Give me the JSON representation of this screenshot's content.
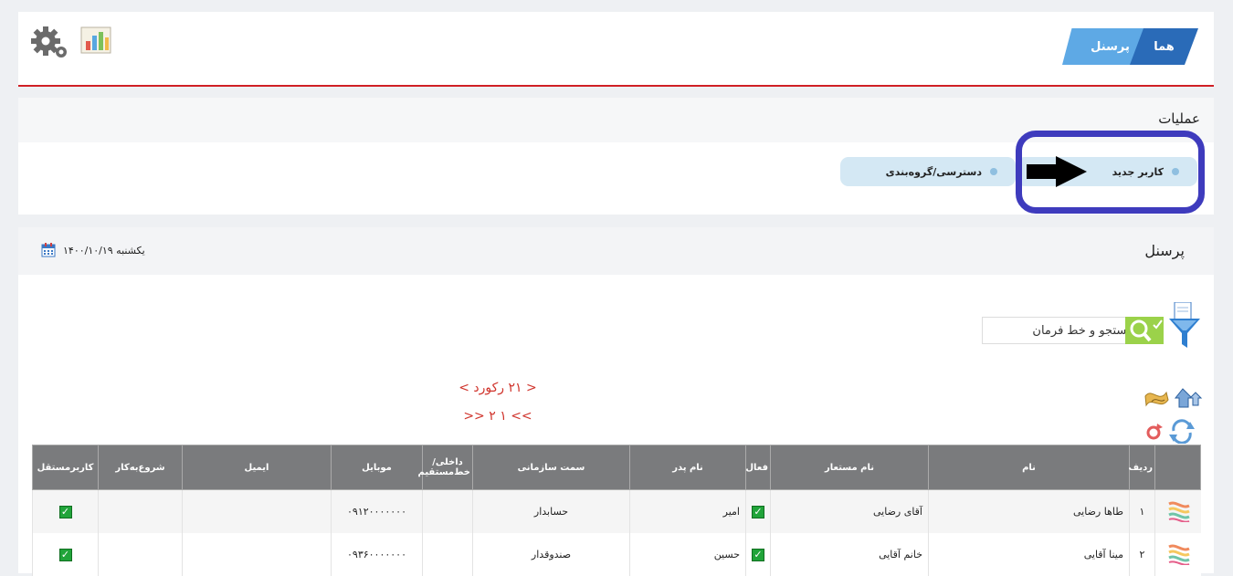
{
  "breadcrumb": {
    "home": "هما",
    "personnel": "پرسنل"
  },
  "operations": {
    "title": "عملیات",
    "new_user": "کاربر جدید",
    "access_grouping": "دسترسی/گروه‌بندی"
  },
  "panel": {
    "title": "پرسنل",
    "date": "یکشنبه ۱۴۰۰/۱۰/۱۹"
  },
  "search": {
    "value": "جستجو و خط فرمان"
  },
  "pager": {
    "records": "< ۲۱ رکورد >",
    "pages": ">> ۱ ۲ <<"
  },
  "table": {
    "headers": [
      "ردیف",
      "نام",
      "نام مستعار",
      "فعال",
      "نام پدر",
      "سمت سازمانی",
      "داخلی/ خط‌مستقیم",
      "موبایل",
      "ایمیل",
      "شروع‌به‌کار",
      "کاربرمستقل"
    ],
    "rows": [
      {
        "row": "۱",
        "name": "طاها رضایی",
        "alias": "آقای رضایی",
        "father": "امیر",
        "position": "حسابدار",
        "internal": "",
        "mobile": "۰۹۱۲۰۰۰۰۰۰۰",
        "email": "",
        "start": ""
      },
      {
        "row": "۲",
        "name": "مینا آقایی",
        "alias": "خانم آقایی",
        "father": "حسین",
        "position": "صندوقدار",
        "internal": "",
        "mobile": "۰۹۳۶۰۰۰۰۰۰۰",
        "email": "",
        "start": ""
      }
    ]
  },
  "colors": {
    "accent_red": "#d01f25",
    "breadcrumb_dark": "#2a6bb8",
    "breadcrumb_light": "#5ea9e5",
    "highlight": "#3e3bbd",
    "table_header": "#7a7b7d",
    "check_green": "#21a43a"
  }
}
